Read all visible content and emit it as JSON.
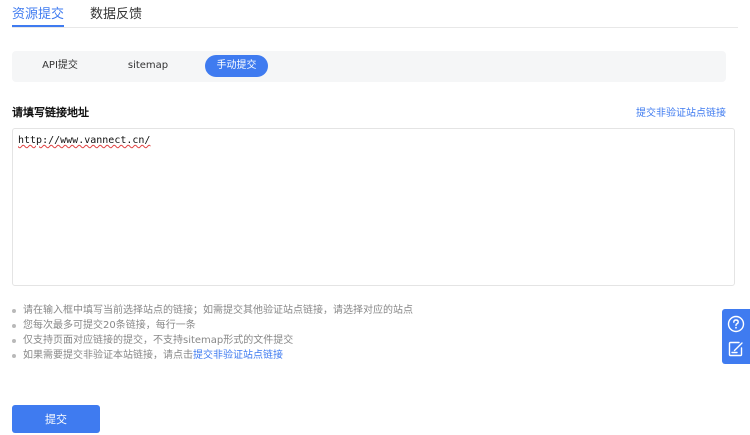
{
  "tabs": [
    {
      "label": "资源提交",
      "active": true
    },
    {
      "label": "数据反馈",
      "active": false
    }
  ],
  "segment": {
    "items": [
      "API提交",
      "sitemap",
      "手动提交"
    ],
    "selected": "手动提交"
  },
  "form": {
    "title": "请填写链接地址",
    "link_right": "提交非验证站点链接",
    "textarea_value": "http://www.vannect.cn/"
  },
  "tips": {
    "items": [
      "请在输入框中填写当前选择站点的链接；如需提交其他验证站点链接，请选择对应的站点",
      "您每次最多可提交20条链接，每行一条",
      "仅支持页面对应链接的提交，不支持sitemap形式的文件提交"
    ],
    "last_prefix": "如果需要提交非验证本站链接，请点击",
    "last_link": "提交非验证站点链接"
  },
  "submit_label": "提交",
  "side_icons": [
    "help-icon",
    "feedback-icon"
  ],
  "colors": {
    "accent": "#3f7bf0"
  }
}
